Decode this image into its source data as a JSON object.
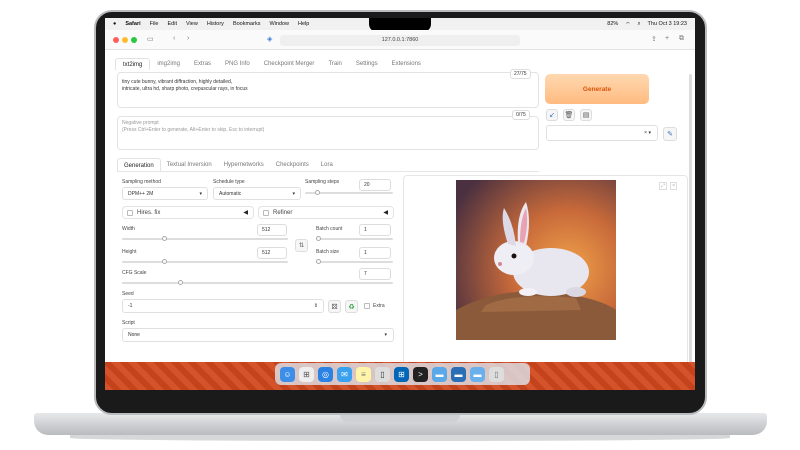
{
  "menubar": {
    "app_name": "Safari",
    "items": [
      "File",
      "Edit",
      "View",
      "History",
      "Bookmarks",
      "Window",
      "Help"
    ],
    "status_left": "82%",
    "status_right": "Thu Oct 3  19:23"
  },
  "browser": {
    "url": "127.0.0.1:7860"
  },
  "tabs": [
    "txt2img",
    "img2img",
    "Extras",
    "PNG Info",
    "Checkpoint Merger",
    "Train",
    "Settings",
    "Extensions"
  ],
  "prompt": {
    "text": "tiny cute bunny, vibrant diffraction, highly detailed,\nintricate, ultra hd, sharp photo, crepuscular rays, in focus",
    "counter": "27/75"
  },
  "negative_prompt": {
    "placeholder_title": "Negative prompt",
    "placeholder_hint": "(Press Ctrl+Enter to generate, Alt+Enter to skip, Esc to interrupt)",
    "counter": "0/75"
  },
  "generate_label": "Generate",
  "sub_tabs": [
    "Generation",
    "Textual Inversion",
    "Hypernetworks",
    "Checkpoints",
    "Lora"
  ],
  "params": {
    "sampling_method_label": "Sampling method",
    "sampling_method_value": "DPM++ 2M",
    "schedule_type_label": "Schedule type",
    "schedule_type_value": "Automatic",
    "sampling_steps_label": "Sampling steps",
    "sampling_steps_value": "20",
    "hires_fix_label": "Hires. fix",
    "refiner_label": "Refiner",
    "width_label": "Width",
    "width_value": "512",
    "height_label": "Height",
    "height_value": "512",
    "batch_count_label": "Batch count",
    "batch_count_value": "1",
    "batch_size_label": "Batch size",
    "batch_size_value": "1",
    "cfg_label": "CFG Scale",
    "cfg_value": "7",
    "seed_label": "Seed",
    "seed_value": "-1",
    "extra_label": "Extra",
    "script_label": "Script",
    "script_value": "None"
  },
  "colors": {
    "accent": "#ff7a1a",
    "wallpaper": "#d4532a"
  }
}
